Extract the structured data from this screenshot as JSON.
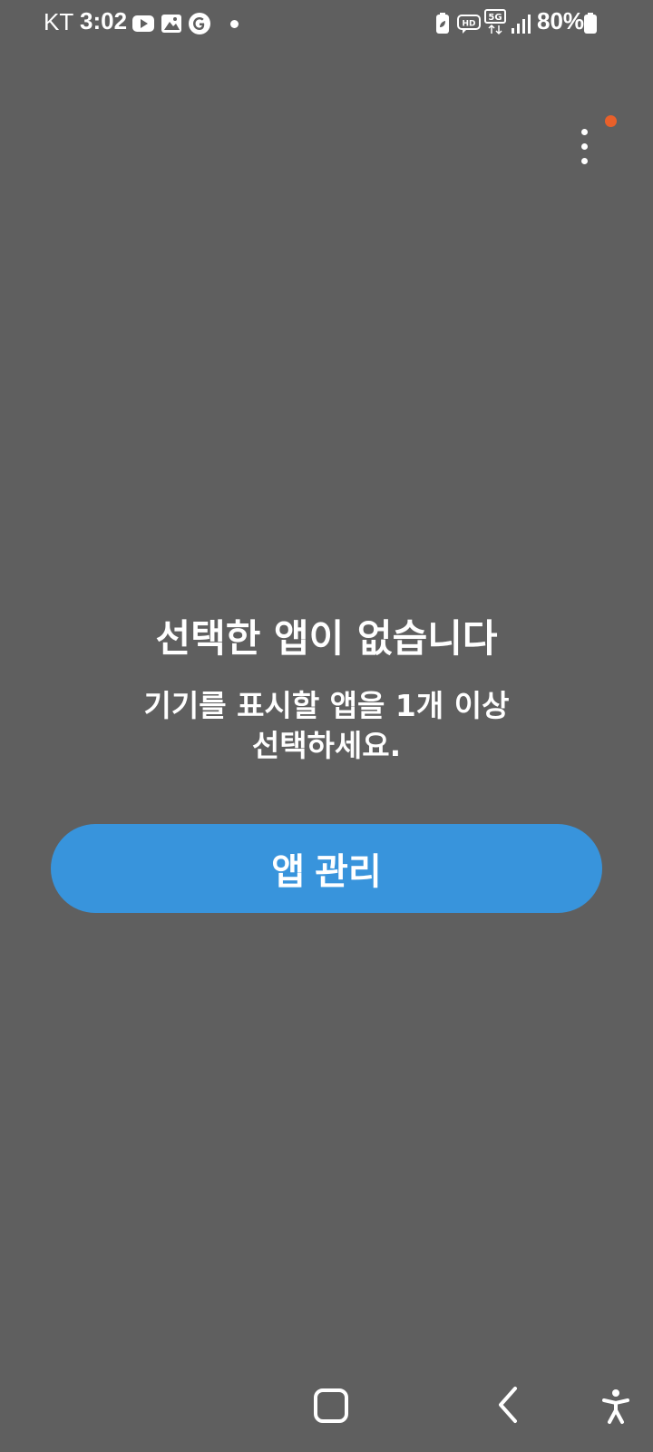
{
  "status_bar": {
    "carrier": "KT",
    "time": "3:02",
    "battery_percent": "80%",
    "icons": [
      "youtube-icon",
      "gallery-icon",
      "google-icon",
      "notification-dot",
      "battery-saver-icon",
      "hd-voice-icon",
      "5g-icon",
      "signal-icon",
      "battery-icon"
    ]
  },
  "menu": {
    "icon": "more-vert-icon",
    "badge_color": "#e9602a"
  },
  "empty_state": {
    "title": "선택한 앱이 없습니다",
    "description": "기기를 표시할 앱을 1개 이상\n선택하세요."
  },
  "actions": {
    "manage_apps_label": "앱 관리",
    "button_color": "#3894dc"
  },
  "nav_bar": {
    "icons": [
      "home-icon",
      "back-icon",
      "accessibility-icon"
    ]
  }
}
